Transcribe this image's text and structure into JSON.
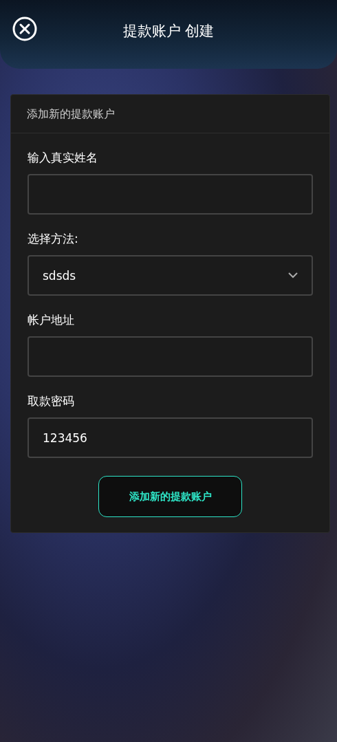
{
  "header": {
    "title": "提款账户 创建"
  },
  "card": {
    "title": "添加新的提款账户",
    "fields": [
      {
        "kind": "text",
        "label": "输入真实姓名"
      },
      {
        "kind": "select",
        "label": "选择方法:",
        "value": "sdsds"
      },
      {
        "kind": "text",
        "label": "帐户地址"
      },
      {
        "kind": "text",
        "label": "取款密码",
        "value": "123456"
      }
    ],
    "submit": "添加新的提款账户"
  }
}
